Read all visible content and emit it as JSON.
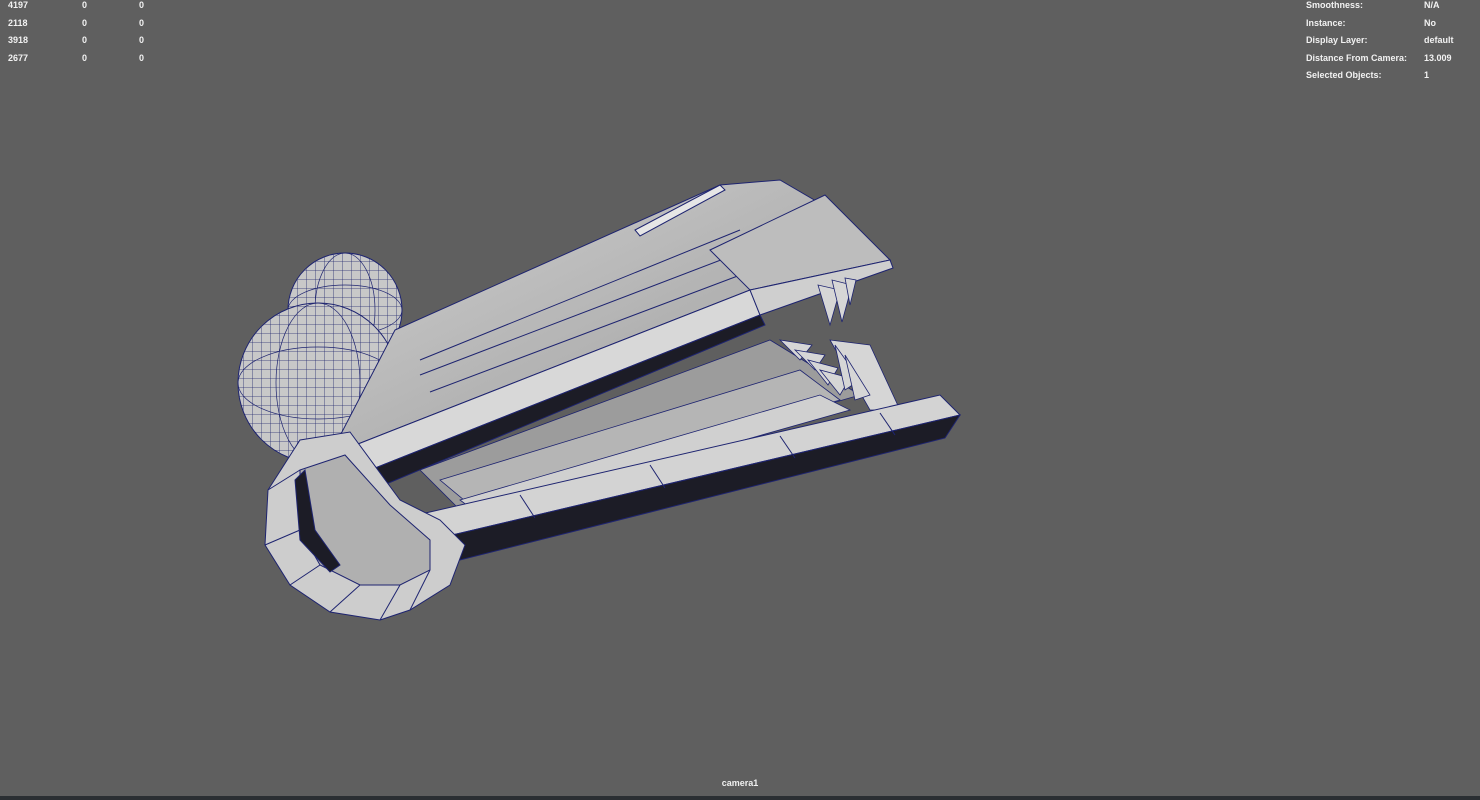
{
  "poly_stats": {
    "rows": [
      [
        "4197",
        "0",
        "0"
      ],
      [
        "2118",
        "0",
        "0"
      ],
      [
        "3918",
        "0",
        "0"
      ],
      [
        "2677",
        "0",
        "0"
      ]
    ]
  },
  "object_info": {
    "rows": [
      {
        "label": "Smoothness:",
        "value": "N/A"
      },
      {
        "label": "Instance:",
        "value": "No"
      },
      {
        "label": "Display Layer:",
        "value": "default"
      },
      {
        "label": "Distance From Camera:",
        "value": "13.009"
      },
      {
        "label": "Selected Objects:",
        "value": "1"
      }
    ]
  },
  "camera": {
    "name": "camera1"
  },
  "colors": {
    "viewport_bg": "#5f5f5f",
    "mesh_fill": "#c4c4c4",
    "mesh_shadow": "#1c1c26",
    "wireframe": "#1e2470"
  }
}
